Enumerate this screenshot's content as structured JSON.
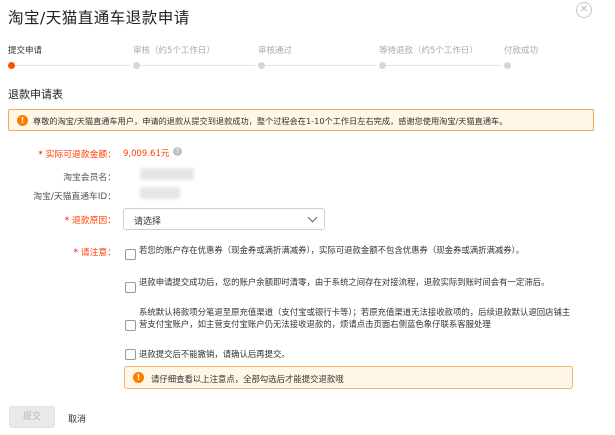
{
  "dialog": {
    "title": "淘宝/天猫直通车退款申请"
  },
  "steps": [
    {
      "label": "提交申请",
      "active": true
    },
    {
      "label": "审核（约5个工作日）",
      "active": false
    },
    {
      "label": "审核通过",
      "active": false
    },
    {
      "label": "等待退款（约5个工作日）",
      "active": false
    },
    {
      "label": "付款成功",
      "active": false
    }
  ],
  "section_title": "退款申请表",
  "notice": {
    "icon": "exclamation-icon",
    "text": "尊敬的淘宝/天猫直通车用户，申请的退款从提交到退款成功，整个过程会在1-10个工作日左右完成，感谢您使用淘宝/天猫直通车。"
  },
  "form": {
    "refundable_amount": {
      "required_mark": "*",
      "label": "实际可退款金额：",
      "value": "9,009.61元"
    },
    "member_name": {
      "label": "淘宝会员名："
    },
    "account_id": {
      "label": "淘宝/天猫直通车ID："
    },
    "reason": {
      "required_mark": "*",
      "label": "退款原因：",
      "selected": "请选择"
    }
  },
  "notes": {
    "required_mark": "*",
    "label": "请注意：",
    "items": [
      {
        "checked": false,
        "text": "若您的账户存在优惠券（现金券或满折满减券），实际可退款金额不包含优惠券（现金券或满折满减券）。"
      },
      {
        "checked": false,
        "text": "退款申请提交成功后，您的账户余额即时清零，由于系统之间存在对接流程，退款实际到账时间会有一定滞后。"
      },
      {
        "checked": false,
        "text": "系统默认将款项分笔退至原充值渠道（支付宝或银行卡等）；若原充值渠道无法接收款项的，后续退款默认退回店铺主营支付宝账户，如主营支付宝账户仍无法接收退款的，烦请点击页面右侧蓝色象仔联系客服处理"
      },
      {
        "checked": false,
        "text": "退款提交后不能撤销，请确认后再提交。"
      }
    ]
  },
  "warning": {
    "icon": "exclamation-icon",
    "text": "请仔细查看以上注意点，全部勾选后才能提交退款哦"
  },
  "actions": {
    "submit": "提交",
    "cancel": "取消"
  },
  "colors": {
    "accent": "#ff5000",
    "required": "#ff0000",
    "amount": "#ff3c00",
    "notice_bg": "#fff7e6",
    "notice_border": "#f7a94f"
  }
}
